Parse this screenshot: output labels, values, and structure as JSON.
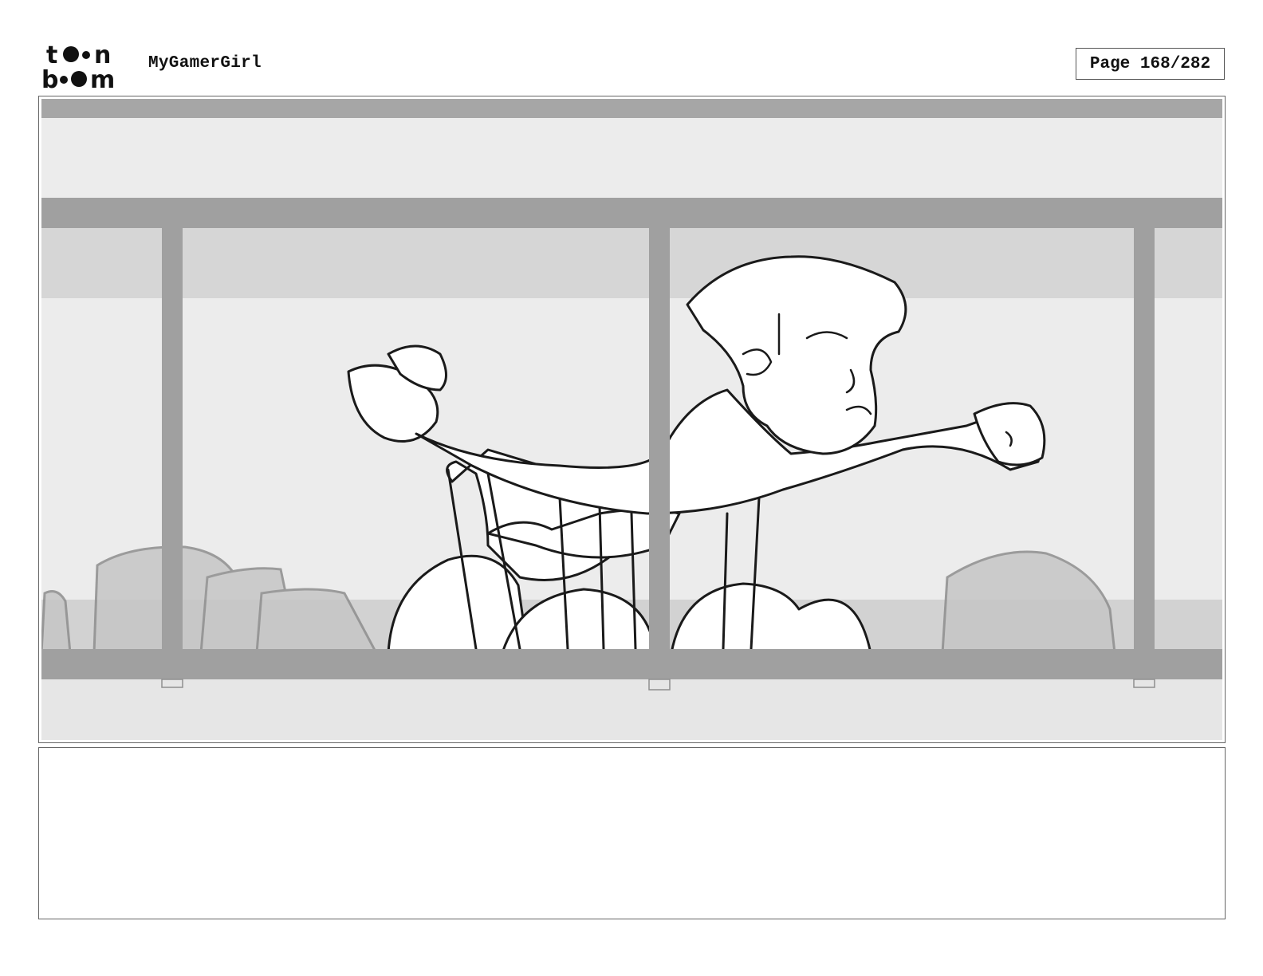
{
  "header": {
    "logo_text": "toon boom",
    "project_title": "MyGamerGirl",
    "page_label": "Page 168/282"
  },
  "panel": {
    "notes": ""
  },
  "colors": {
    "bar_dark": "#a0a0a0",
    "bg_light": "#ececec",
    "bg_band": "#d6d6d6",
    "floor": "#cfcfcf",
    "ink": "#1a1a1a"
  }
}
